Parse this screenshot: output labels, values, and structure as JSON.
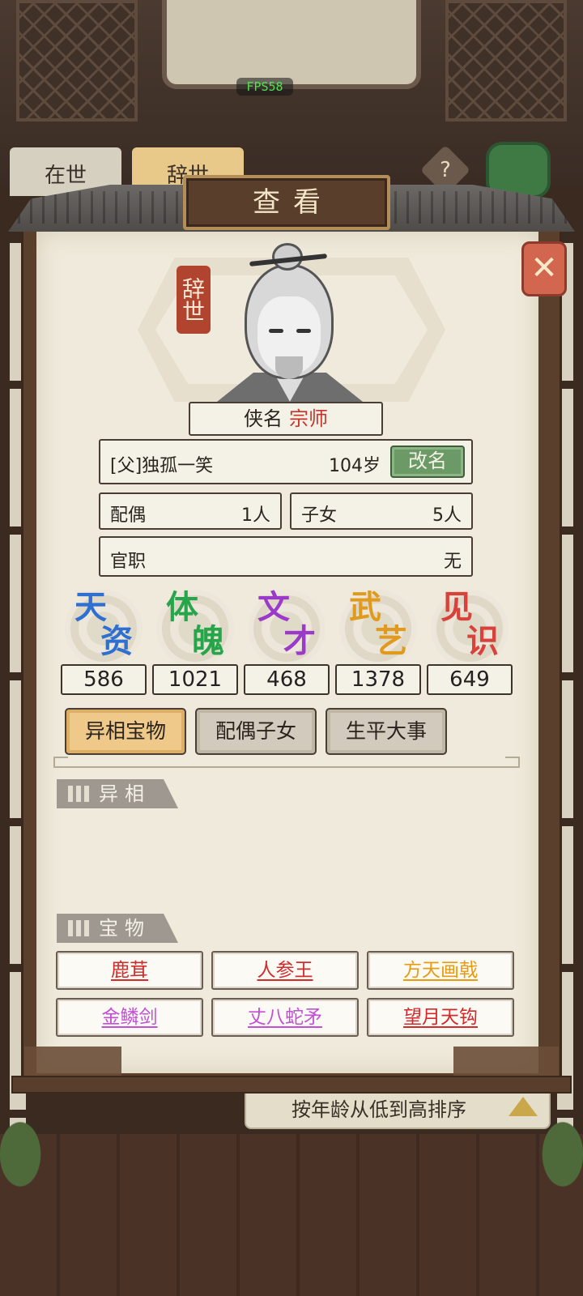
{
  "hud": {
    "fps": "FPS58"
  },
  "background": {
    "tabs": [
      "在世",
      "辞世"
    ],
    "help_icon": "?",
    "sort_label": "按年龄从低到高排序"
  },
  "dialog": {
    "title": "查看",
    "close_icon": "close-icon",
    "status_stamp": "辞世",
    "name_label": "侠名",
    "name_value": "宗师",
    "father": "[父]独孤一笑",
    "age": "104岁",
    "rename_label": "改名",
    "spouse_label": "配偶",
    "spouse_value": "1人",
    "children_label": "子女",
    "children_value": "5人",
    "office_label": "官职",
    "office_value": "无",
    "stats": [
      {
        "c1": "天",
        "c2": "资",
        "value": "586",
        "color": "#2f6fd0"
      },
      {
        "c1": "体",
        "c2": "魄",
        "value": "1021",
        "color": "#27a54a"
      },
      {
        "c1": "文",
        "c2": "才",
        "value": "468",
        "color": "#9b39c8"
      },
      {
        "c1": "武",
        "c2": "艺",
        "value": "1378",
        "color": "#e09a1e"
      },
      {
        "c1": "见",
        "c2": "识",
        "value": "649",
        "color": "#d9423a"
      }
    ],
    "tabs": [
      {
        "label": "异相宝物",
        "active": true
      },
      {
        "label": "配偶子女",
        "active": false
      },
      {
        "label": "生平大事",
        "active": false
      }
    ],
    "section_aberration": "异相",
    "section_treasure": "宝物",
    "treasures": [
      {
        "name": "鹿茸",
        "color": "#d42a2a"
      },
      {
        "name": "人参王",
        "color": "#d42a2a"
      },
      {
        "name": "方天画戟",
        "color": "#e99a10"
      },
      {
        "name": "金鳞剑",
        "color": "#c24fd6"
      },
      {
        "name": "丈八蛇矛",
        "color": "#c24fd6"
      },
      {
        "name": "望月天钩",
        "color": "#d42a2a"
      }
    ]
  }
}
